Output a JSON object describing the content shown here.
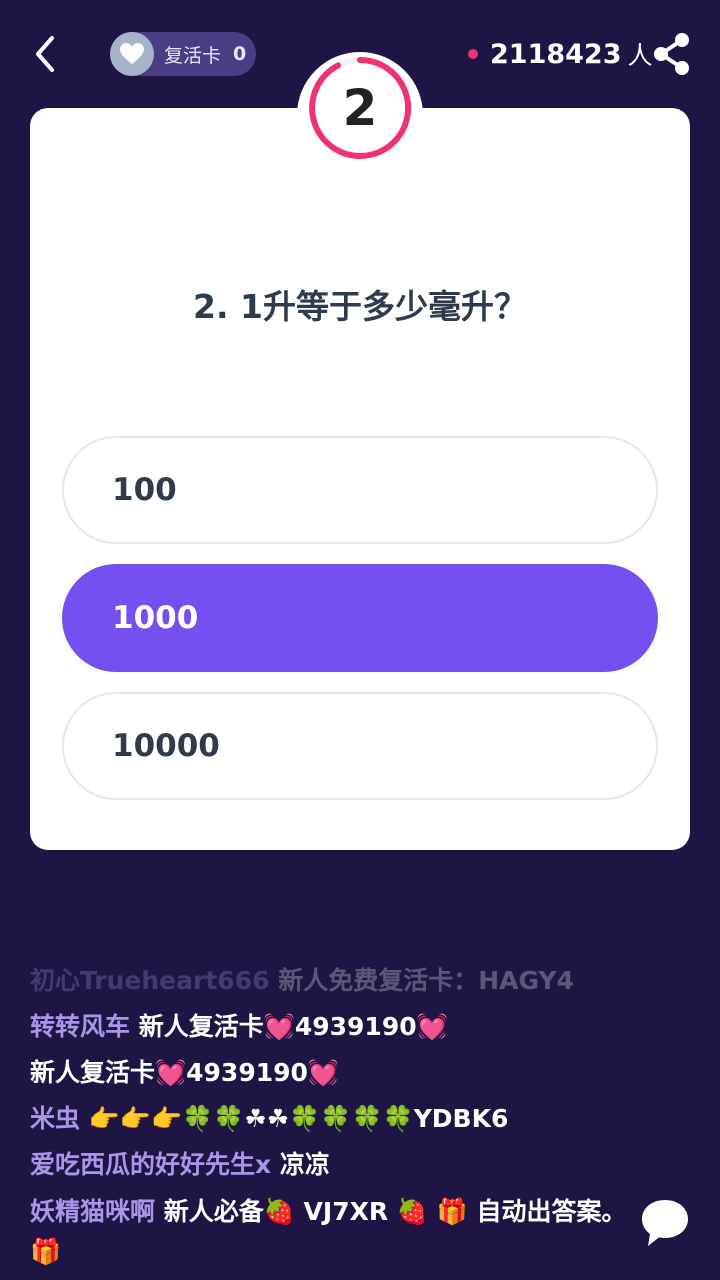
{
  "header": {
    "revive_label": "复活卡",
    "revive_count": "0",
    "online_count": "2118423",
    "online_unit": "人"
  },
  "quiz": {
    "question_number": "2",
    "question": "2. 1升等于多少毫升？",
    "options": [
      {
        "label": "100",
        "selected": false
      },
      {
        "label": "1000",
        "selected": true
      },
      {
        "label": "10000",
        "selected": false
      }
    ]
  },
  "comments": [
    {
      "user": "初心Trueheart666",
      "text": " 新人免费复活卡：HAGY4"
    },
    {
      "user": "转转风车",
      "text": " 新人复活卡💓4939190💓"
    },
    {
      "user": "",
      "text": "新人复活卡💓4939190💓"
    },
    {
      "user": "米虫",
      "text": " 👉👉👉🍀🍀☘☘🍀🍀🍀🍀YDBK6"
    },
    {
      "user": "爱吃西瓜的好好先生x",
      "text": " 凉凉"
    },
    {
      "user": "妖精猫咪啊",
      "text": "  新人必备🍓 VJ7XR 🍓 🎁  自动出答案。🎁"
    }
  ],
  "colors": {
    "background": "#1e1544",
    "accent": "#754ff0",
    "timer": "#f0326f",
    "username": "#a897e8"
  },
  "icons": [
    "back-icon",
    "heart-icon",
    "share-icon",
    "chat-bubble-icon"
  ]
}
